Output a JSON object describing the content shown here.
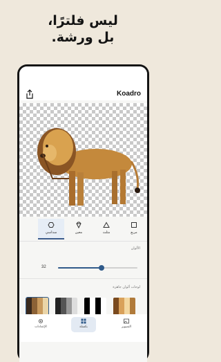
{
  "promo": {
    "line1": "ليس فلترًا،",
    "line2": "بل ورشة."
  },
  "header": {
    "title": "Koadro",
    "share_icon": "share-icon"
  },
  "shapes": [
    {
      "label": "مربع",
      "icon": "square-icon",
      "active": false
    },
    {
      "label": "مثلث",
      "icon": "triangle-icon",
      "active": false
    },
    {
      "label": "معين",
      "icon": "diamond-icon",
      "active": false
    },
    {
      "label": "سداسي",
      "icon": "hexagon-icon",
      "active": true
    }
  ],
  "colors_section": {
    "label": "الألوان",
    "value_text": "32",
    "value": 32,
    "fraction": 0.55
  },
  "palettes_section": {
    "label": "لوحات ألوان جاهزة",
    "palettes": [
      {
        "colors": [
          "#3a2a1e",
          "#8c6236",
          "#c89a5e",
          "#ead5a8"
        ],
        "selected": true
      },
      {
        "colors": [
          "#222222",
          "#555555",
          "#999999",
          "#dddddd"
        ],
        "selected": false
      },
      {
        "colors": [
          "#000000",
          "#ffffff",
          "#000000",
          "#ffffff"
        ],
        "selected": false
      },
      {
        "colors": [
          "#7a4a1e",
          "#d9a15a",
          "#f3d7a0",
          "#b07a3a"
        ],
        "selected": false
      }
    ]
  },
  "bottom_nav": [
    {
      "label": "التصوير",
      "icon": "image-icon",
      "active": false
    },
    {
      "label": "بكسلة",
      "icon": "grid-icon",
      "active": true
    },
    {
      "label": "الإعدادات",
      "icon": "gear-icon",
      "active": false
    }
  ],
  "colors": {
    "accent": "#2f5a8a",
    "background": "#efe8dc",
    "frame": "#141414"
  }
}
